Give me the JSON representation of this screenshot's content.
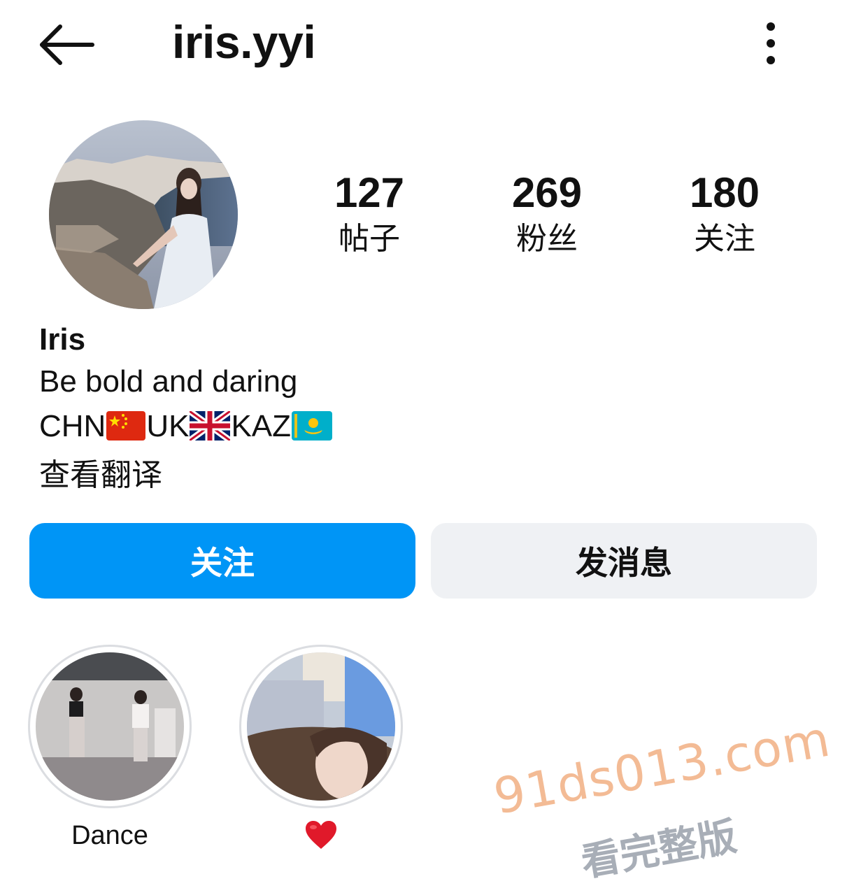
{
  "header": {
    "username": "iris.yyi",
    "back_icon": "arrow-left-icon",
    "more_icon": "more-vertical-icon"
  },
  "stats": [
    {
      "value": "127",
      "label": "帖子"
    },
    {
      "value": "269",
      "label": "粉丝"
    },
    {
      "value": "180",
      "label": "关注"
    }
  ],
  "bio": {
    "display_name": "Iris",
    "tagline": "Be bold and daring",
    "countries": [
      "CHN",
      "UK",
      "KAZ"
    ],
    "flags": [
      "china-flag-icon",
      "uk-flag-icon",
      "kazakhstan-flag-icon"
    ],
    "translate_link": "查看翻译"
  },
  "actions": {
    "follow_label": "关注",
    "message_label": "发消息"
  },
  "highlights": [
    {
      "label": "Dance"
    },
    {
      "label": "❤️",
      "icon": "heart-icon"
    }
  ],
  "watermark": {
    "site": "91ds013.com",
    "text": "看完整版"
  },
  "colors": {
    "accent": "#0095f6",
    "secondary_button": "#eff1f4",
    "heart": "#e0192a",
    "watermark_site": "#f2b48a",
    "watermark_text": "#9aa1ab"
  }
}
